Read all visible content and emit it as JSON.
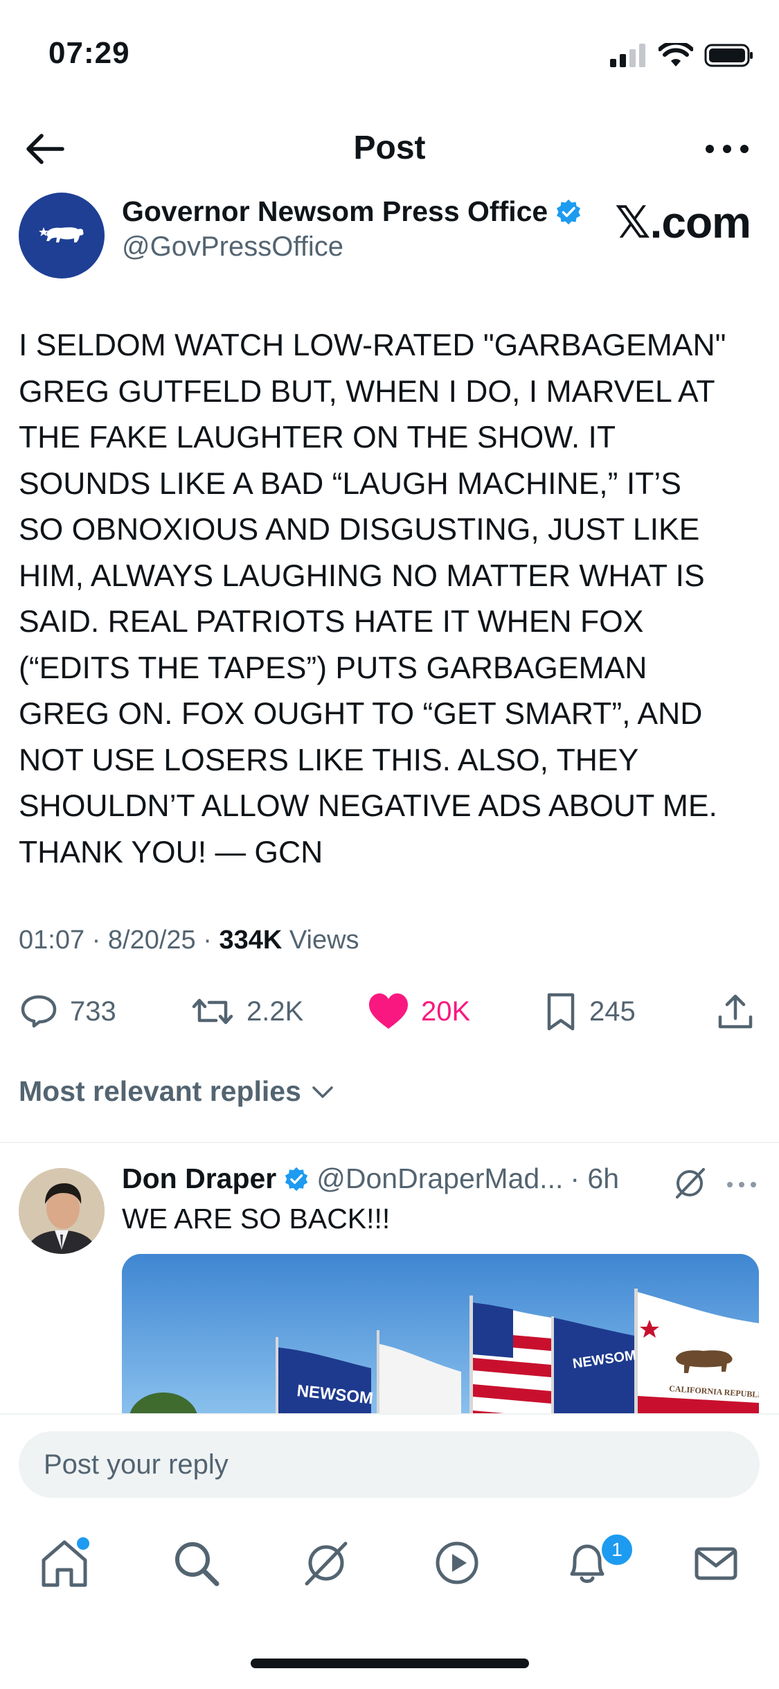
{
  "status_bar": {
    "time": "07:29"
  },
  "nav": {
    "title": "Post"
  },
  "author": {
    "name": "Governor Newsom Press Office",
    "handle": "@GovPressOffice",
    "watermark": "𝕏.com"
  },
  "post": {
    "text": "I SELDOM WATCH LOW-RATED \"GARBAGEMAN\"\nGREG GUTFELD BUT, WHEN I DO, I MARVEL AT\nTHE FAKE LAUGHTER ON THE SHOW. IT\nSOUNDS LIKE A BAD “LAUGH MACHINE,” IT’S\nSO OBNOXIOUS AND DISGUSTING, JUST LIKE\nHIM, ALWAYS LAUGHING NO MATTER WHAT IS\nSAID. REAL PATRIOTS HATE IT WHEN FOX\n(“EDITS THE TAPES”) PUTS GARBAGEMAN\nGREG ON. FOX OUGHT TO “GET SMART”, AND\nNOT USE LOSERS LIKE THIS. ALSO, THEY\nSHOULDN’T ALLOW NEGATIVE ADS ABOUT ME.\nTHANK YOU! — GCN",
    "time": "01:07",
    "date": "8/20/25",
    "views_count": "334K",
    "views_label": "Views"
  },
  "actions": {
    "replies": "733",
    "reposts": "2.2K",
    "likes": "20K",
    "bookmarks": "245"
  },
  "replies_filter": {
    "label": "Most relevant replies"
  },
  "reply": {
    "name": "Don Draper",
    "handle": "@DonDraperMad...",
    "time": "· 6h",
    "text": "WE ARE SO BACK!!!",
    "flag_texts": [
      "NEWSOM",
      "NEWSOM",
      "CALIFORNIA REPUBLIC"
    ]
  },
  "composer": {
    "placeholder": "Post your reply"
  },
  "tab_bar": {
    "notifications_badge": "1"
  },
  "colors": {
    "accent": "#1d9bf0",
    "like": "#f91880",
    "secondary_text": "#536471",
    "primary_text": "#0f1419"
  }
}
